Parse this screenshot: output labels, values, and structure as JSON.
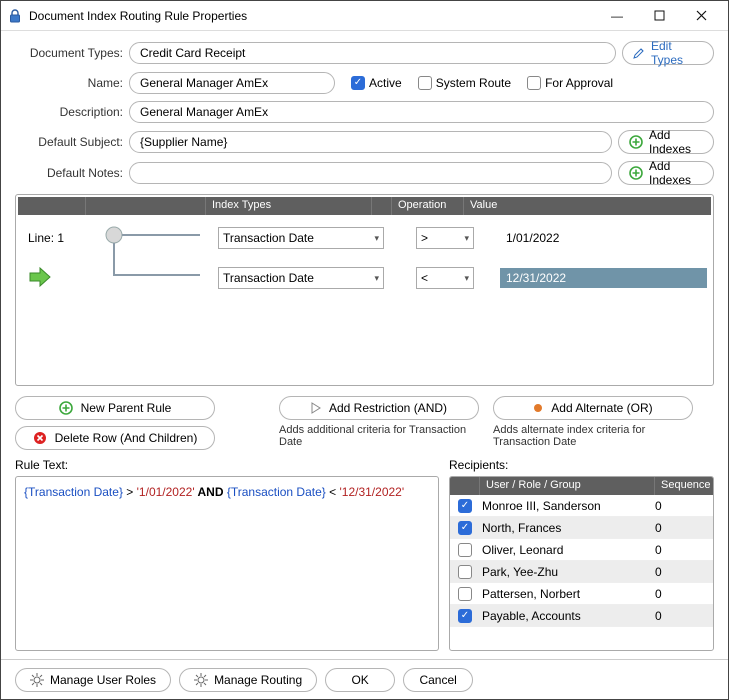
{
  "window": {
    "title": "Document Index Routing Rule Properties",
    "minimize": "—",
    "maximize": "▢",
    "close": "✕"
  },
  "form": {
    "doc_types_label": "Document Types:",
    "doc_types_value": "Credit Card Receipt",
    "edit_types_btn": "Edit Types",
    "name_label": "Name:",
    "name_value": "General Manager AmEx",
    "active_label": "Active",
    "system_route_label": "System Route",
    "for_approval_label": "For Approval",
    "desc_label": "Description:",
    "desc_value": "General Manager AmEx",
    "def_subject_label": "Default Subject:",
    "def_subject_value": "{Supplier Name}",
    "def_notes_label": "Default Notes:",
    "def_notes_value": "",
    "add_indexes_btn": "Add Indexes"
  },
  "grid": {
    "col_index_types": "Index Types",
    "col_operation": "Operation",
    "col_value": "Value",
    "line_label": "Line:",
    "line_num": "1",
    "rows": [
      {
        "type": "Transaction Date",
        "op": ">",
        "value": "1/01/2022",
        "selected": false
      },
      {
        "type": "Transaction Date",
        "op": "<",
        "value": "12/31/2022",
        "selected": true
      }
    ]
  },
  "actions": {
    "new_parent": "New Parent Rule",
    "delete_row": "Delete Row (And Children)",
    "add_and": "Add Restriction (AND)",
    "add_and_hint": "Adds additional criteria for Transaction Date",
    "add_or": "Add Alternate (OR)",
    "add_or_hint": "Adds alternate index criteria for Transaction Date"
  },
  "rule_text": {
    "label": "Rule Text:",
    "parts": {
      "f1": "{Transaction Date}",
      "op1": " > ",
      "v1": "'1/01/2022'",
      "and": " AND ",
      "f2": "{Transaction Date}",
      "op2": " < ",
      "v2": "'12/31/2022'"
    }
  },
  "recipients": {
    "label": "Recipients:",
    "col_name": "User / Role / Group",
    "col_seq": "Sequence",
    "rows": [
      {
        "checked": true,
        "name": "Monroe III, Sanderson",
        "seq": "0"
      },
      {
        "checked": true,
        "name": "North, Frances",
        "seq": "0"
      },
      {
        "checked": false,
        "name": "Oliver, Leonard",
        "seq": "0"
      },
      {
        "checked": false,
        "name": "Park, Yee-Zhu",
        "seq": "0"
      },
      {
        "checked": false,
        "name": "Pattersen, Norbert",
        "seq": "0"
      },
      {
        "checked": true,
        "name": "Payable, Accounts",
        "seq": "0"
      }
    ]
  },
  "footer": {
    "manage_roles": "Manage User Roles",
    "manage_routing": "Manage Routing",
    "ok": "OK",
    "cancel": "Cancel"
  }
}
